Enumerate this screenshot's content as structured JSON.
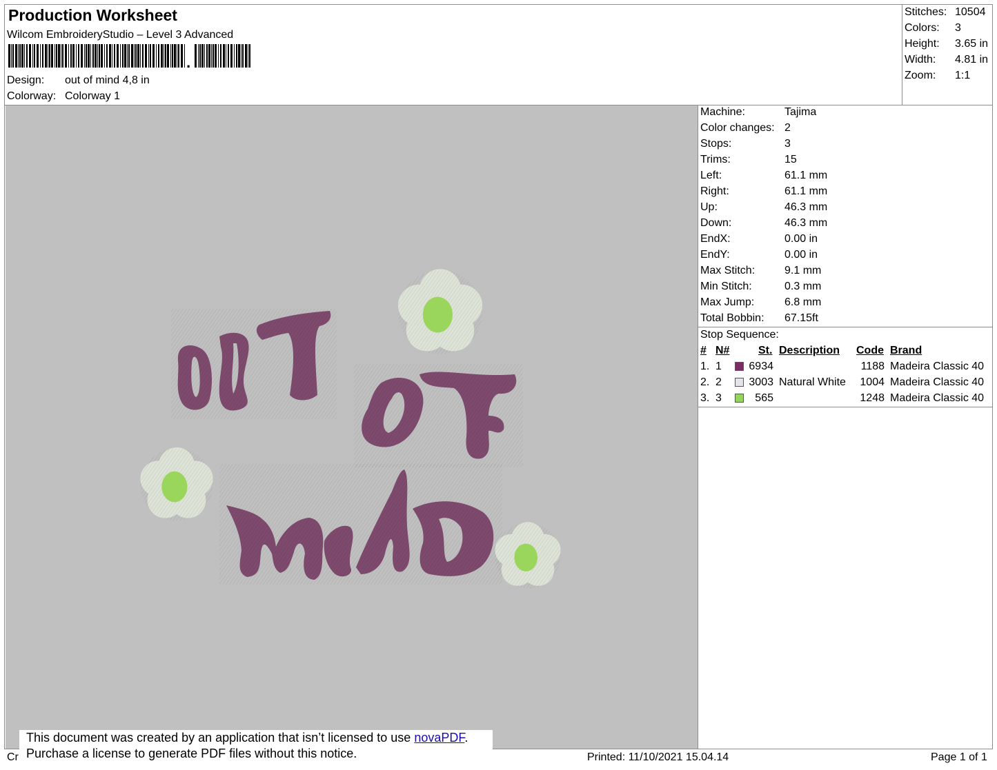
{
  "header": {
    "title": "Production Worksheet",
    "software": "Wilcom EmbroideryStudio – Level 3 Advanced",
    "design_label": "Design:",
    "design_value": "out of mind 4,8 in",
    "colorway_label": "Colorway:",
    "colorway_value": "Colorway 1"
  },
  "stats": [
    {
      "label": "Stitches:",
      "value": "10504"
    },
    {
      "label": "Colors:",
      "value": "3"
    },
    {
      "label": "Height:",
      "value": "3.65 in"
    },
    {
      "label": "Width:",
      "value": "4.81 in"
    },
    {
      "label": "Zoom:",
      "value": "1:1"
    }
  ],
  "machine_info": [
    {
      "label": "Machine:",
      "value": "Tajima"
    },
    {
      "label": "Color changes:",
      "value": "2"
    },
    {
      "label": "Stops:",
      "value": "3"
    },
    {
      "label": "Trims:",
      "value": "15"
    },
    {
      "label": "Left:",
      "value": "61.1 mm"
    },
    {
      "label": "Right:",
      "value": "61.1 mm"
    },
    {
      "label": "Up:",
      "value": "46.3 mm"
    },
    {
      "label": "Down:",
      "value": "46.3 mm"
    },
    {
      "label": "EndX:",
      "value": "0.00 in"
    },
    {
      "label": "EndY:",
      "value": "0.00 in"
    },
    {
      "label": "Max Stitch:",
      "value": "9.1 mm"
    },
    {
      "label": "Min Stitch:",
      "value": "0.3 mm"
    },
    {
      "label": "Max Jump:",
      "value": "6.8 mm"
    },
    {
      "label": "Total Bobbin:",
      "value": "67.15ft"
    }
  ],
  "stop_sequence": {
    "title": "Stop Sequence:",
    "columns": {
      "num": "#",
      "n": "N#",
      "st": "St.",
      "description": "Description",
      "code": "Code",
      "brand": "Brand"
    },
    "rows": [
      {
        "num": "1.",
        "n": "1",
        "color": "#7a2d63",
        "st": "6934",
        "description": "",
        "code": "1188",
        "brand": "Madeira Classic 40"
      },
      {
        "num": "2.",
        "n": "2",
        "color": "#e4e4ea",
        "st": "3003",
        "description": "Natural White",
        "code": "1004",
        "brand": "Madeira Classic 40"
      },
      {
        "num": "3.",
        "n": "3",
        "color": "#96d45f",
        "st": "565",
        "description": "",
        "code": "1248",
        "brand": "Madeira Classic 40"
      }
    ]
  },
  "design_art": {
    "words": [
      "OUT",
      "OF",
      "MIND"
    ],
    "letter_color": "#7e4a6d",
    "petal_color": "#dde3d6",
    "center_color": "#9bd65c",
    "background": "#c0c0c0"
  },
  "footer": {
    "created_prefix": "Cr",
    "printed": "Printed: 11/10/2021 15.04.14",
    "page": "Page 1 of 1"
  },
  "notice": {
    "line1_prefix": "This document was created by an application that isn’t licensed to use ",
    "link": "novaPDF",
    "line1_suffix": ".",
    "line2": "Purchase a license to generate PDF files without this notice."
  }
}
